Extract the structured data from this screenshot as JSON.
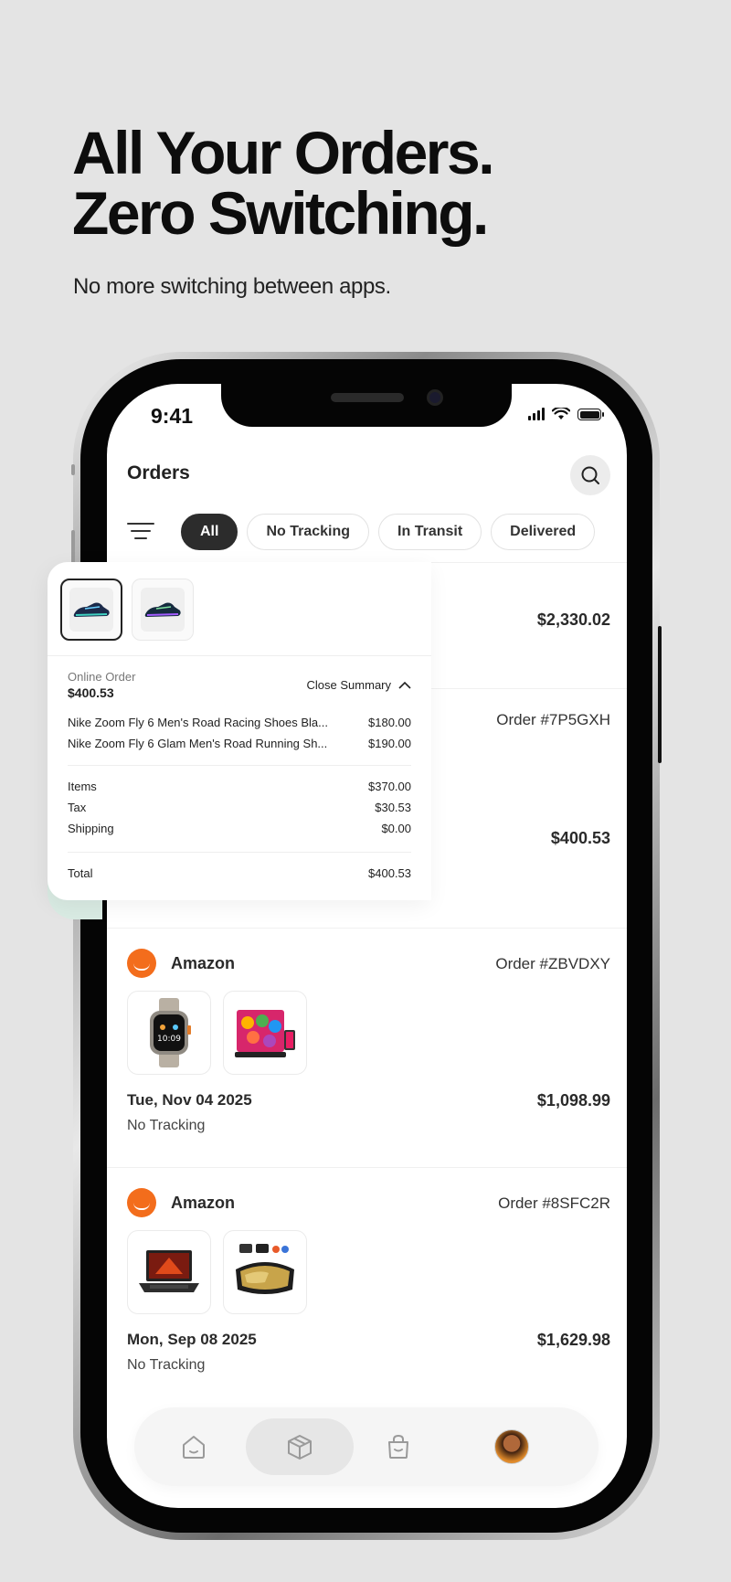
{
  "marketing": {
    "headline_line1": "All Your Orders.",
    "headline_line2": "Zero Switching.",
    "subheadline": "No more switching between apps."
  },
  "status_bar": {
    "time": "9:41"
  },
  "header": {
    "title": "Orders"
  },
  "filters": {
    "chips": [
      "All",
      "No Tracking",
      "In Transit",
      "Delivered"
    ],
    "active": "All"
  },
  "orders": [
    {
      "total": "$2,330.02"
    },
    {
      "order_number": "Order #7P5GXH",
      "total": "$400.53"
    },
    {
      "store": "Amazon",
      "order_number": "Order #ZBVDXY",
      "date": "Tue, Nov 04 2025",
      "total": "$1,098.99",
      "status": "No Tracking",
      "items": [
        "smartwatch",
        "tablet-case"
      ]
    },
    {
      "store": "Amazon",
      "order_number": "Order #8SFC2R",
      "date": "Mon, Sep 08 2025",
      "total": "$1,629.98",
      "status": "No Tracking",
      "items": [
        "laptop",
        "goggles"
      ]
    }
  ],
  "summary_card": {
    "order_type": "Online Order",
    "order_total": "$400.53",
    "toggle_label": "Close Summary",
    "line_items": [
      {
        "name": "Nike Zoom Fly 6 Men's Road Racing Shoes Bla...",
        "price": "$180.00"
      },
      {
        "name": "Nike Zoom Fly 6 Glam Men's Road Running Sh...",
        "price": "$190.00"
      }
    ],
    "breakdown": [
      {
        "label": "Items",
        "value": "$370.00"
      },
      {
        "label": "Tax",
        "value": "$30.53"
      },
      {
        "label": "Shipping",
        "value": "$0.00"
      }
    ],
    "total_label": "Total",
    "total_value": "$400.53"
  },
  "bottom_nav": {
    "items": [
      "home-icon",
      "package-icon",
      "bag-icon",
      "profile-avatar"
    ],
    "active": "package-icon"
  },
  "colors": {
    "background": "#e4e4e4",
    "amazon_orange": "#f36d1c",
    "active_chip": "#2c2c2c"
  }
}
